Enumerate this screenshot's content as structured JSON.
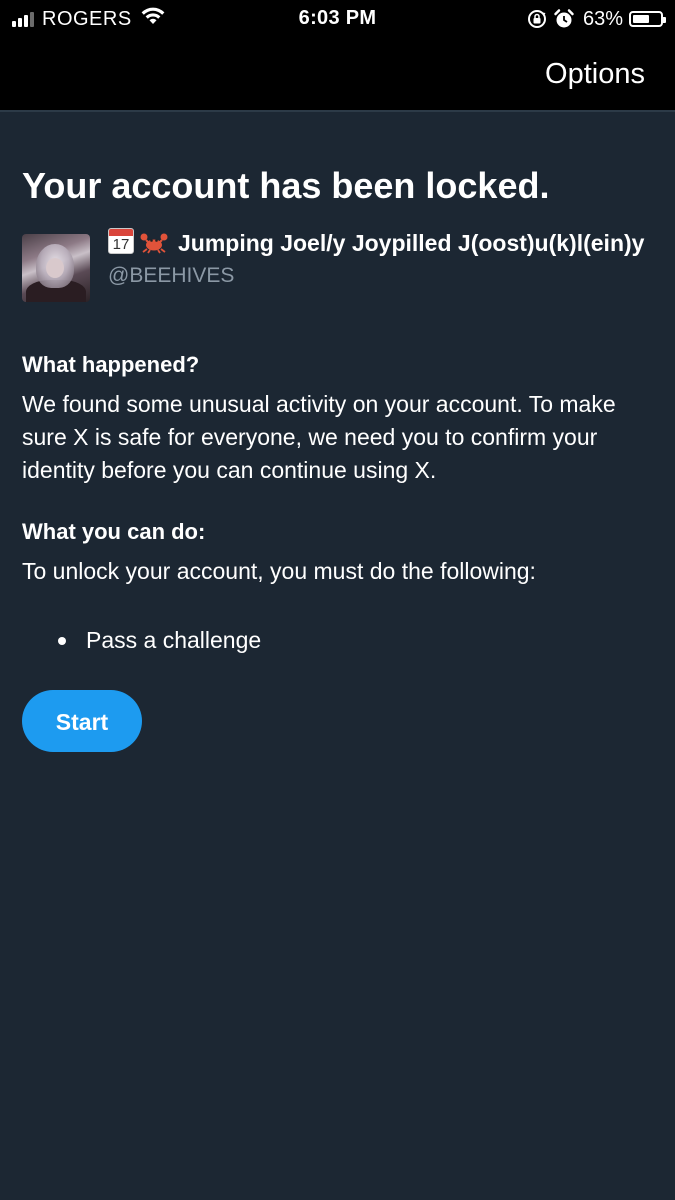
{
  "status_bar": {
    "carrier": "ROGERS",
    "time": "6:03 PM",
    "battery_percent": "63%",
    "battery_level": 0.63,
    "signal_bars_active": 3,
    "signal_bars_total": 4,
    "icons": [
      "signal-icon",
      "wifi-icon",
      "orientation-lock-icon",
      "alarm-icon",
      "battery-icon"
    ]
  },
  "nav": {
    "options_label": "Options"
  },
  "page": {
    "title": "Your account has been locked."
  },
  "account": {
    "calendar_day": "17",
    "display_name": "Jumping Joel/y Joypilled J(oost)u(k)l(ein)y",
    "handle": "@BEEHIVES",
    "name_icons": [
      "calendar-emoji-icon",
      "crab-emoji-icon"
    ]
  },
  "what_happened": {
    "heading": "What happened?",
    "text": "We found some unusual activity on your account. To make sure X is safe for everyone, we need you to confirm your identity before you can continue using X."
  },
  "what_you_can_do": {
    "heading": "What you can do:",
    "text": "To unlock your account, you must do the following:",
    "items": [
      "Pass a challenge"
    ]
  },
  "actions": {
    "start_label": "Start"
  },
  "colors": {
    "background": "#1c2733",
    "bar_background": "#000000",
    "accent": "#1d9bf0",
    "secondary_text": "#8b98a5"
  }
}
